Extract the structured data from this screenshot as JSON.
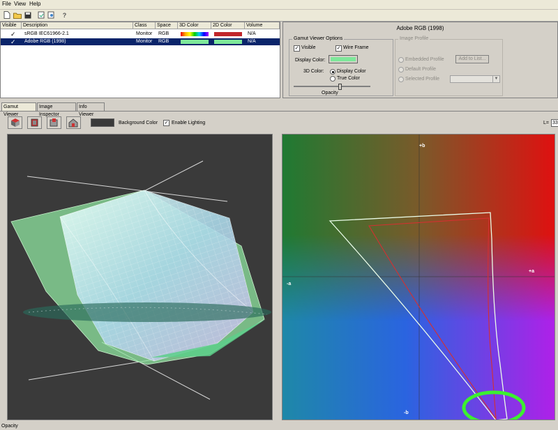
{
  "menubar": {
    "items": [
      "File",
      "View",
      "Help"
    ]
  },
  "toolbar": {
    "icons": [
      "new-file-icon",
      "open-folder-icon",
      "save-icon",
      "import-icon",
      "export-icon",
      "help-icon"
    ],
    "help_glyph": "?"
  },
  "profiles_table": {
    "columns": [
      "Visible",
      "Description",
      "Class",
      "Space",
      "3D Color",
      "2D Color",
      "Volume"
    ],
    "rows": [
      {
        "visible": "✓",
        "description": "sRGB IEC61966-2.1",
        "class": "Monitor",
        "space": "RGB",
        "color3d": "rainbow",
        "color2d": "#c0262a",
        "volume": "N/A",
        "selected": false
      },
      {
        "visible": "✓",
        "description": "Adobe RGB (1998)",
        "class": "Monitor",
        "space": "RGB",
        "color3d": "#7ee89a",
        "color2d": "#7ee89a",
        "volume": "N/A",
        "selected": true
      }
    ]
  },
  "info_panel": {
    "title": "Adobe RGB (1998)",
    "gamut_viewer_options": {
      "title": "Gamut Viewer Options",
      "visible_label": "Visible",
      "visible_checked": true,
      "wireframe_label": "Wire Frame",
      "wireframe_checked": true,
      "display_color_label": "Display Color:",
      "display_color": "#7ee89a",
      "color3d_label": "3D Color:",
      "radio_display_color": "Display Color",
      "radio_true_color": "True Color",
      "opacity_label": "Opacity",
      "opacity": 0.15
    },
    "image_profile": {
      "title": "Image Profile",
      "embedded_label": "Embedded Profile",
      "default_label": "Default Profile",
      "selected_label": "Selected Profile",
      "add_to_list_label": "Add to List..."
    }
  },
  "tabs": [
    "Gamut Viewer",
    "Image Inspector",
    "Info Viewer"
  ],
  "viewer_toolbar": {
    "background_color_label": "Background Color",
    "background_color": "#3a3a3a",
    "enable_lighting_label": "Enable Lighting",
    "enable_lighting_checked": true,
    "l_label": "L=",
    "l_value": "33"
  },
  "ab_plot": {
    "plus_b": "+b",
    "minus_b": "-b",
    "minus_a": "-a",
    "plus_a": "+a"
  },
  "status": {
    "text": "Opacity"
  }
}
